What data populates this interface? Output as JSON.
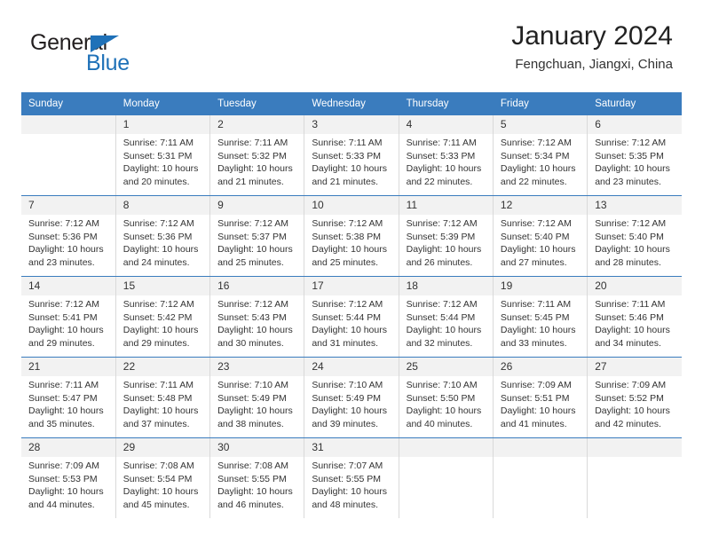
{
  "brand": {
    "name_part1": "General",
    "name_part2": "Blue",
    "accent_color": "#1f71b8"
  },
  "header": {
    "title": "January 2024",
    "subtitle": "Fengchuan, Jiangxi, China"
  },
  "calendar": {
    "header_bg": "#3a7cbe",
    "daynum_bg": "#f2f2f2",
    "weekdays": [
      "Sunday",
      "Monday",
      "Tuesday",
      "Wednesday",
      "Thursday",
      "Friday",
      "Saturday"
    ],
    "weeks": [
      [
        {
          "day": "",
          "sunrise": "",
          "sunset": "",
          "daylight": "",
          "daylight2": ""
        },
        {
          "day": "1",
          "sunrise": "Sunrise: 7:11 AM",
          "sunset": "Sunset: 5:31 PM",
          "daylight": "Daylight: 10 hours",
          "daylight2": "and 20 minutes."
        },
        {
          "day": "2",
          "sunrise": "Sunrise: 7:11 AM",
          "sunset": "Sunset: 5:32 PM",
          "daylight": "Daylight: 10 hours",
          "daylight2": "and 21 minutes."
        },
        {
          "day": "3",
          "sunrise": "Sunrise: 7:11 AM",
          "sunset": "Sunset: 5:33 PM",
          "daylight": "Daylight: 10 hours",
          "daylight2": "and 21 minutes."
        },
        {
          "day": "4",
          "sunrise": "Sunrise: 7:11 AM",
          "sunset": "Sunset: 5:33 PM",
          "daylight": "Daylight: 10 hours",
          "daylight2": "and 22 minutes."
        },
        {
          "day": "5",
          "sunrise": "Sunrise: 7:12 AM",
          "sunset": "Sunset: 5:34 PM",
          "daylight": "Daylight: 10 hours",
          "daylight2": "and 22 minutes."
        },
        {
          "day": "6",
          "sunrise": "Sunrise: 7:12 AM",
          "sunset": "Sunset: 5:35 PM",
          "daylight": "Daylight: 10 hours",
          "daylight2": "and 23 minutes."
        }
      ],
      [
        {
          "day": "7",
          "sunrise": "Sunrise: 7:12 AM",
          "sunset": "Sunset: 5:36 PM",
          "daylight": "Daylight: 10 hours",
          "daylight2": "and 23 minutes."
        },
        {
          "day": "8",
          "sunrise": "Sunrise: 7:12 AM",
          "sunset": "Sunset: 5:36 PM",
          "daylight": "Daylight: 10 hours",
          "daylight2": "and 24 minutes."
        },
        {
          "day": "9",
          "sunrise": "Sunrise: 7:12 AM",
          "sunset": "Sunset: 5:37 PM",
          "daylight": "Daylight: 10 hours",
          "daylight2": "and 25 minutes."
        },
        {
          "day": "10",
          "sunrise": "Sunrise: 7:12 AM",
          "sunset": "Sunset: 5:38 PM",
          "daylight": "Daylight: 10 hours",
          "daylight2": "and 25 minutes."
        },
        {
          "day": "11",
          "sunrise": "Sunrise: 7:12 AM",
          "sunset": "Sunset: 5:39 PM",
          "daylight": "Daylight: 10 hours",
          "daylight2": "and 26 minutes."
        },
        {
          "day": "12",
          "sunrise": "Sunrise: 7:12 AM",
          "sunset": "Sunset: 5:40 PM",
          "daylight": "Daylight: 10 hours",
          "daylight2": "and 27 minutes."
        },
        {
          "day": "13",
          "sunrise": "Sunrise: 7:12 AM",
          "sunset": "Sunset: 5:40 PM",
          "daylight": "Daylight: 10 hours",
          "daylight2": "and 28 minutes."
        }
      ],
      [
        {
          "day": "14",
          "sunrise": "Sunrise: 7:12 AM",
          "sunset": "Sunset: 5:41 PM",
          "daylight": "Daylight: 10 hours",
          "daylight2": "and 29 minutes."
        },
        {
          "day": "15",
          "sunrise": "Sunrise: 7:12 AM",
          "sunset": "Sunset: 5:42 PM",
          "daylight": "Daylight: 10 hours",
          "daylight2": "and 29 minutes."
        },
        {
          "day": "16",
          "sunrise": "Sunrise: 7:12 AM",
          "sunset": "Sunset: 5:43 PM",
          "daylight": "Daylight: 10 hours",
          "daylight2": "and 30 minutes."
        },
        {
          "day": "17",
          "sunrise": "Sunrise: 7:12 AM",
          "sunset": "Sunset: 5:44 PM",
          "daylight": "Daylight: 10 hours",
          "daylight2": "and 31 minutes."
        },
        {
          "day": "18",
          "sunrise": "Sunrise: 7:12 AM",
          "sunset": "Sunset: 5:44 PM",
          "daylight": "Daylight: 10 hours",
          "daylight2": "and 32 minutes."
        },
        {
          "day": "19",
          "sunrise": "Sunrise: 7:11 AM",
          "sunset": "Sunset: 5:45 PM",
          "daylight": "Daylight: 10 hours",
          "daylight2": "and 33 minutes."
        },
        {
          "day": "20",
          "sunrise": "Sunrise: 7:11 AM",
          "sunset": "Sunset: 5:46 PM",
          "daylight": "Daylight: 10 hours",
          "daylight2": "and 34 minutes."
        }
      ],
      [
        {
          "day": "21",
          "sunrise": "Sunrise: 7:11 AM",
          "sunset": "Sunset: 5:47 PM",
          "daylight": "Daylight: 10 hours",
          "daylight2": "and 35 minutes."
        },
        {
          "day": "22",
          "sunrise": "Sunrise: 7:11 AM",
          "sunset": "Sunset: 5:48 PM",
          "daylight": "Daylight: 10 hours",
          "daylight2": "and 37 minutes."
        },
        {
          "day": "23",
          "sunrise": "Sunrise: 7:10 AM",
          "sunset": "Sunset: 5:49 PM",
          "daylight": "Daylight: 10 hours",
          "daylight2": "and 38 minutes."
        },
        {
          "day": "24",
          "sunrise": "Sunrise: 7:10 AM",
          "sunset": "Sunset: 5:49 PM",
          "daylight": "Daylight: 10 hours",
          "daylight2": "and 39 minutes."
        },
        {
          "day": "25",
          "sunrise": "Sunrise: 7:10 AM",
          "sunset": "Sunset: 5:50 PM",
          "daylight": "Daylight: 10 hours",
          "daylight2": "and 40 minutes."
        },
        {
          "day": "26",
          "sunrise": "Sunrise: 7:09 AM",
          "sunset": "Sunset: 5:51 PM",
          "daylight": "Daylight: 10 hours",
          "daylight2": "and 41 minutes."
        },
        {
          "day": "27",
          "sunrise": "Sunrise: 7:09 AM",
          "sunset": "Sunset: 5:52 PM",
          "daylight": "Daylight: 10 hours",
          "daylight2": "and 42 minutes."
        }
      ],
      [
        {
          "day": "28",
          "sunrise": "Sunrise: 7:09 AM",
          "sunset": "Sunset: 5:53 PM",
          "daylight": "Daylight: 10 hours",
          "daylight2": "and 44 minutes."
        },
        {
          "day": "29",
          "sunrise": "Sunrise: 7:08 AM",
          "sunset": "Sunset: 5:54 PM",
          "daylight": "Daylight: 10 hours",
          "daylight2": "and 45 minutes."
        },
        {
          "day": "30",
          "sunrise": "Sunrise: 7:08 AM",
          "sunset": "Sunset: 5:55 PM",
          "daylight": "Daylight: 10 hours",
          "daylight2": "and 46 minutes."
        },
        {
          "day": "31",
          "sunrise": "Sunrise: 7:07 AM",
          "sunset": "Sunset: 5:55 PM",
          "daylight": "Daylight: 10 hours",
          "daylight2": "and 48 minutes."
        },
        {
          "day": "",
          "sunrise": "",
          "sunset": "",
          "daylight": "",
          "daylight2": ""
        },
        {
          "day": "",
          "sunrise": "",
          "sunset": "",
          "daylight": "",
          "daylight2": ""
        },
        {
          "day": "",
          "sunrise": "",
          "sunset": "",
          "daylight": "",
          "daylight2": ""
        }
      ]
    ]
  }
}
